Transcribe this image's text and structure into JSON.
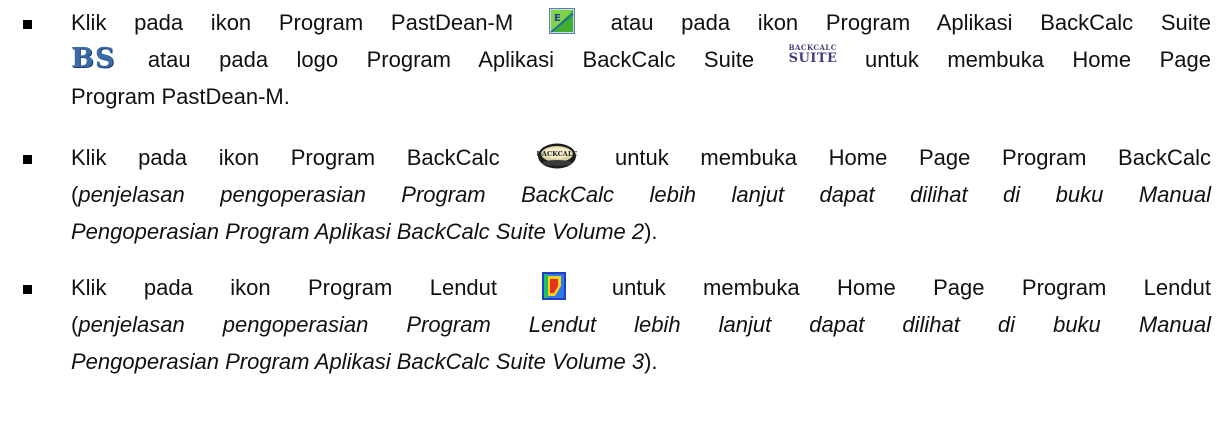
{
  "items": [
    {
      "line1": {
        "t1": "Klik pada ikon Program PastDean-M",
        "t2": "atau pada ikon Program Aplikasi BackCalc Suite"
      },
      "line2": {
        "t1": "atau pada logo Program Aplikasi BackCalc Suite",
        "t2": "untuk membuka Home Page"
      },
      "line3": "Program PastDean-M."
    },
    {
      "line1": {
        "t1": "Klik pada ikon Program BackCalc",
        "t2": "untuk membuka Home Page Program BackCalc"
      },
      "line2": {
        "paren_open": "(",
        "italic": "penjelasan pengoperasian Program BackCalc lebih lanjut dapat dilihat di buku Manual"
      },
      "line3": {
        "italic": "Pengoperasian Program Aplikasi BackCalc Suite Volume 2",
        "paren_close": ")."
      }
    },
    {
      "line1": {
        "t1": "Klik pada ikon Program Lendut",
        "t2": "untuk membuka Home Page Program Lendut"
      },
      "line2": {
        "paren_open": "(",
        "italic": "penjelasan pengoperasian Program Lendut lebih lanjut dapat dilihat di buku Manual"
      },
      "line3": {
        "italic": "Pengoperasian Program Aplikasi BackCalc Suite Volume 3",
        "paren_close": ")."
      }
    }
  ],
  "icons": {
    "pastdean": {
      "name": "pastdean-m-icon",
      "letter": "E"
    },
    "bs": {
      "name": "bs-logo-icon",
      "text": "BS",
      "color": "#3a6aa8"
    },
    "suite": {
      "name": "backcalc-suite-logo-icon",
      "top": "BACKCALC",
      "bottom": "SUITE",
      "color": "#4a3a7a"
    },
    "backcalc": {
      "name": "backcalc-disc-icon",
      "text": "BACKCALC"
    },
    "lendut": {
      "name": "lendut-icon"
    }
  }
}
